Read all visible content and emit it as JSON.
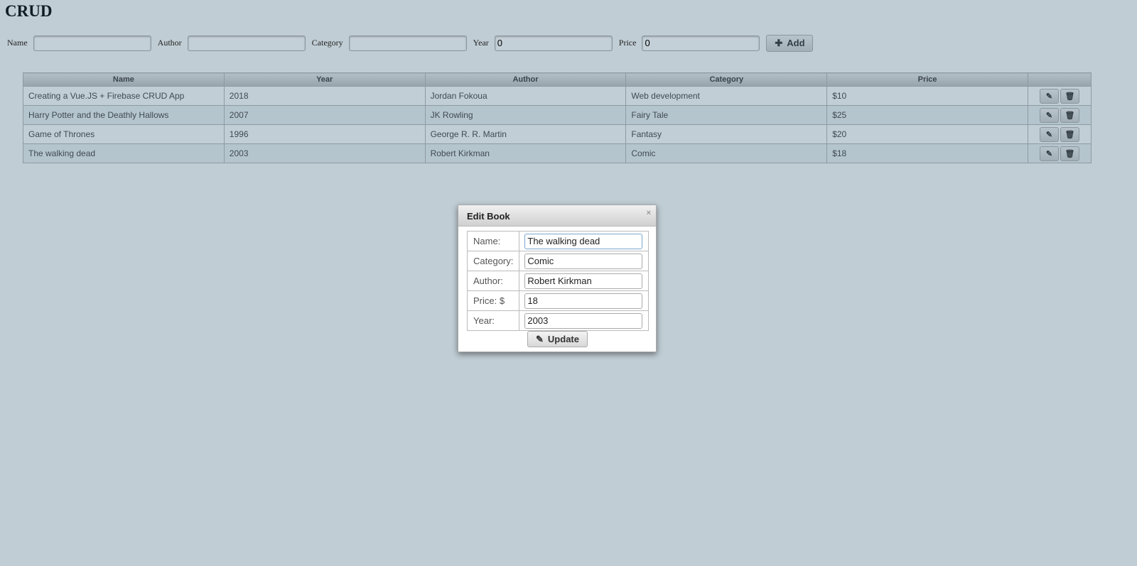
{
  "title": "CRUD",
  "form": {
    "name_label": "Name",
    "author_label": "Author",
    "category_label": "Category",
    "year_label": "Year",
    "price_label": "Price",
    "name": "",
    "author": "",
    "category": "",
    "year": "0",
    "price": "0",
    "add_label": "Add"
  },
  "table": {
    "headers": [
      "Name",
      "Year",
      "Author",
      "Category",
      "Price",
      ""
    ],
    "rows": [
      [
        "Creating a Vue.JS + Firebase CRUD App",
        "2018",
        "Jordan Fokoua",
        "Web development",
        "$10"
      ],
      [
        "Harry Potter and the Deathly Hallows",
        "2007",
        "JK Rowling",
        "Fairy Tale",
        "$25"
      ],
      [
        "Game of Thrones",
        "1996",
        "George R. R. Martin",
        "Fantasy",
        "$20"
      ],
      [
        "The walking dead",
        "2003",
        "Robert Kirkman",
        "Comic",
        "$18"
      ]
    ]
  },
  "modal": {
    "title": "Edit Book",
    "close": "×",
    "labels": [
      "Name:",
      "Category:",
      "Author:",
      "Price: $",
      "Year:"
    ],
    "values": [
      "The walking dead",
      "Comic",
      "Robert Kirkman",
      "18",
      "2003"
    ],
    "update_label": "Update"
  }
}
